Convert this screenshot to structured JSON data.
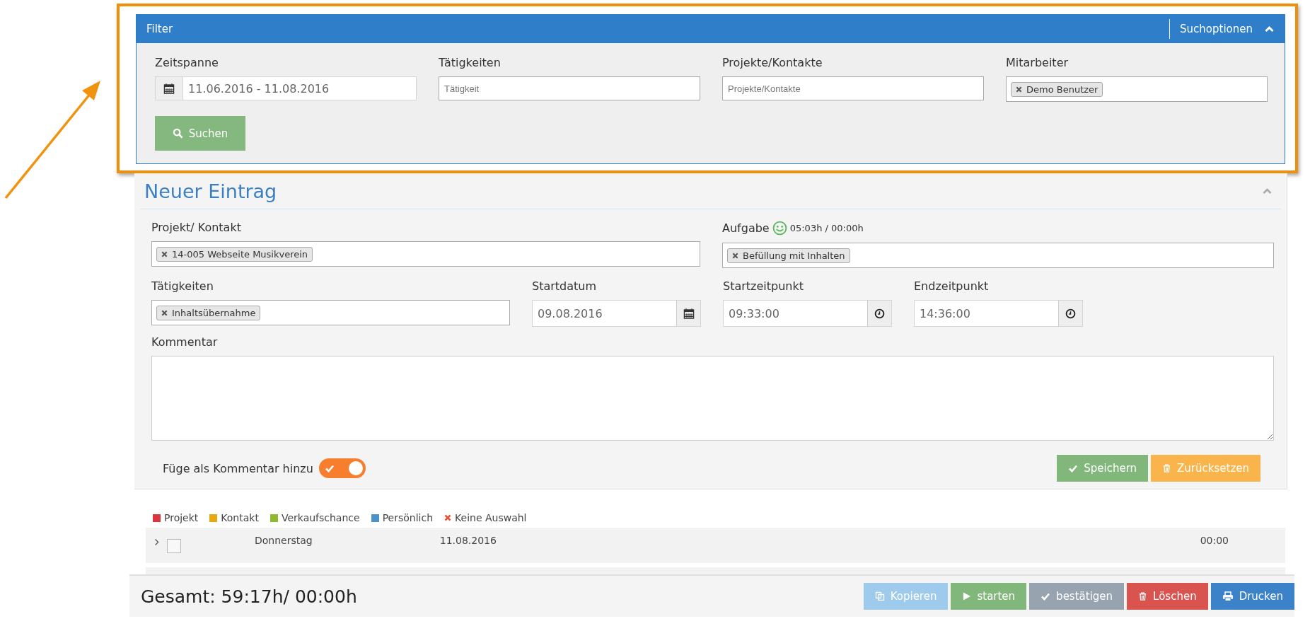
{
  "filter": {
    "title": "Filter",
    "options_label": "Suchoptionen",
    "expanded": true,
    "search_button": "Suchen",
    "fields": [
      {
        "label": "Zeitspanne",
        "kind": "daterange",
        "value": "11.06.2016 - 11.08.2016"
      },
      {
        "label": "Tätigkeiten",
        "kind": "text",
        "placeholder": "Tätigkeit"
      },
      {
        "label": "Projekte/Kontakte",
        "kind": "text",
        "placeholder": "Projekte/Kontakte"
      },
      {
        "label": "Mitarbeiter",
        "kind": "tags",
        "tags": [
          "Demo Benutzer"
        ]
      }
    ]
  },
  "entry": {
    "title": "Neuer Eintrag",
    "expanded": true,
    "project": {
      "label": "Projekt/ Kontakt",
      "tags": [
        "14-005 Webseite Musikverein"
      ]
    },
    "task": {
      "label": "Aufgabe",
      "time": "05:03h / 00:00h",
      "tags": [
        "Befüllung mit Inhalten"
      ]
    },
    "activities": {
      "label": "Tätigkeiten",
      "tags": [
        "Inhaltsübernahme"
      ]
    },
    "start_date": {
      "label": "Startdatum",
      "value": "09.08.2016"
    },
    "start_time": {
      "label": "Startzeitpunkt",
      "value": "09:33:00"
    },
    "end_time": {
      "label": "Endzeitpunkt",
      "value": "14:36:00"
    },
    "comment": {
      "label": "Kommentar"
    },
    "toggle": {
      "label": "Füge als Kommentar hinzu",
      "on": true
    },
    "buttons": [
      {
        "label": "Speichern",
        "kind": "save"
      },
      {
        "label": "Zurücksetzen",
        "kind": "reset"
      }
    ]
  },
  "legend": [
    {
      "label": "Projekt",
      "kind": "square",
      "color": "#d9363e"
    },
    {
      "label": "Kontakt",
      "kind": "square",
      "color": "#e9a80f"
    },
    {
      "label": "Verkaufschance",
      "kind": "square",
      "color": "#8fba2e"
    },
    {
      "label": "Persönlich",
      "kind": "square",
      "color": "#4b92c9"
    },
    {
      "label": "Keine Auswahl",
      "kind": "cross",
      "color": "#e4533a"
    }
  ],
  "rows": [
    {
      "day": "Donnerstag",
      "date": "11.08.2016",
      "duration": "00:00",
      "expanded": false,
      "checked": false
    }
  ],
  "footer": {
    "total": "Gesamt: 59:17h/ 00:00h",
    "buttons": [
      {
        "label": "Kopieren",
        "kind": "copy",
        "disabled": true
      },
      {
        "label": "starten",
        "kind": "start",
        "disabled": false
      },
      {
        "label": "bestätigen",
        "kind": "confirm",
        "disabled": true
      },
      {
        "label": "Löschen",
        "kind": "delete",
        "disabled": false
      },
      {
        "label": "Drucken",
        "kind": "print",
        "disabled": false
      }
    ]
  }
}
